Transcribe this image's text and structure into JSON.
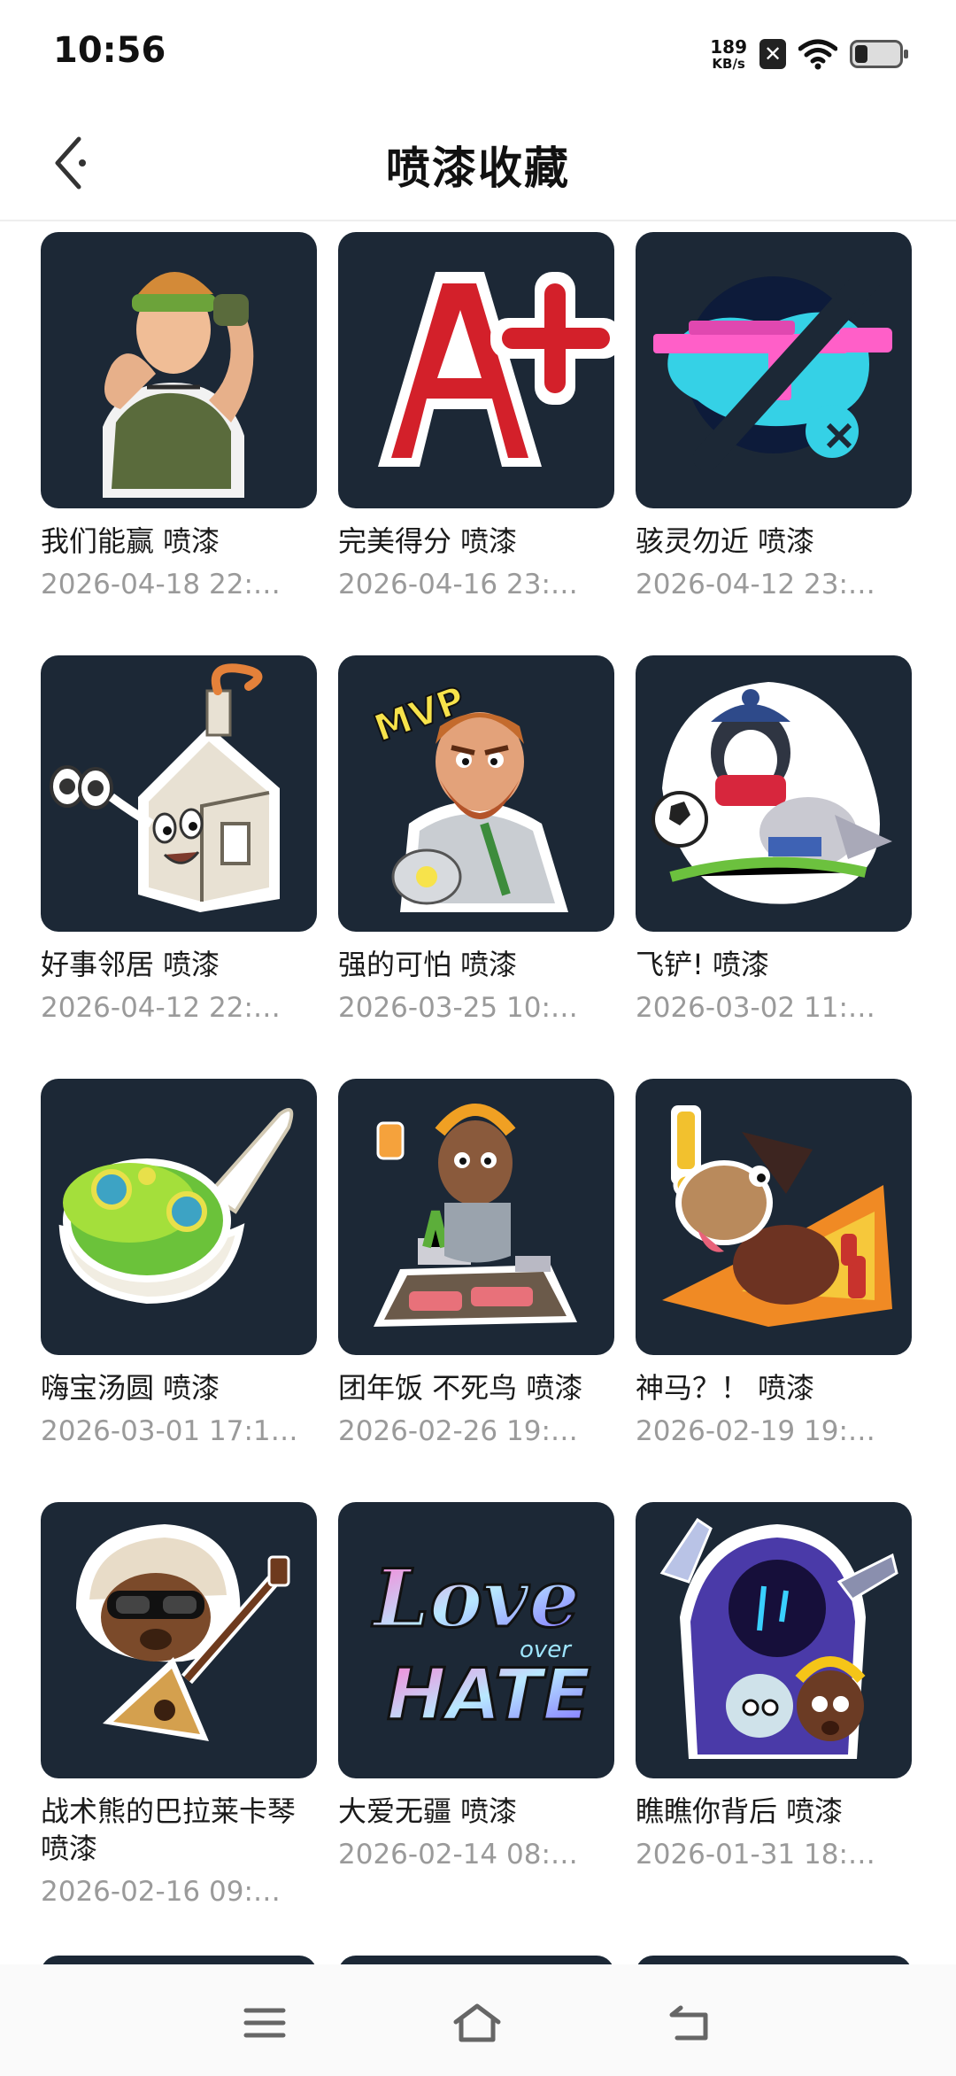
{
  "status_bar": {
    "time": "10:56",
    "net_speed_value": "189",
    "net_speed_unit": "KB/s",
    "icons": [
      "sim-x-icon",
      "wifi-icon",
      "battery-icon"
    ]
  },
  "header": {
    "title": "喷漆收藏",
    "back_icon": "chevron-left-icon"
  },
  "sprays": [
    {
      "title": "我们能赢 喷漆",
      "date": "2026-04-18 22:…",
      "icon": "flexing-soldier-icon"
    },
    {
      "title": "完美得分 喷漆",
      "date": "2026-04-16 23:…",
      "icon": "a-plus-grade-icon"
    },
    {
      "title": "骇灵勿近 喷漆",
      "date": "2026-04-12 23:…",
      "icon": "crossed-out-rifle-icon"
    },
    {
      "title": "好事邻居 喷漆",
      "date": "2026-04-12 22:…",
      "icon": "house-with-binoculars-icon"
    },
    {
      "title": "强的可怕 喷漆",
      "date": "2026-03-25 10:…",
      "icon": "mvp-bearded-hero-icon"
    },
    {
      "title": "飞铲! 喷漆",
      "date": "2026-03-02 11:…",
      "icon": "penguin-slide-tackle-icon"
    },
    {
      "title": "嗨宝汤圆 喷漆",
      "date": "2026-03-01 17:1…",
      "icon": "tangyuan-spoon-icon"
    },
    {
      "title": "团年饭 不死鸟 喷漆",
      "date": "2026-02-26 19:…",
      "icon": "reunion-dinner-icon"
    },
    {
      "title": "神马？！ 喷漆",
      "date": "2026-02-19 19:…",
      "icon": "startled-horse-icon"
    },
    {
      "title": "战术熊的巴拉莱卡琴 喷漆",
      "date": "2026-02-16 09:…",
      "icon": "bear-balalaika-icon"
    },
    {
      "title": "大爱无疆 喷漆",
      "date": "2026-02-14 08:…",
      "icon": "love-over-hate-icon"
    },
    {
      "title": "瞧瞧你背后 喷漆",
      "date": "2026-01-31 18:…",
      "icon": "lurking-reaper-icon"
    }
  ],
  "love_over_hate": {
    "line1": "Love",
    "line2": "over",
    "line3": "HATE"
  },
  "mvp_text": "MVP",
  "nav_bar": {
    "icons": [
      "menu-icon",
      "home-icon",
      "back-icon"
    ]
  }
}
